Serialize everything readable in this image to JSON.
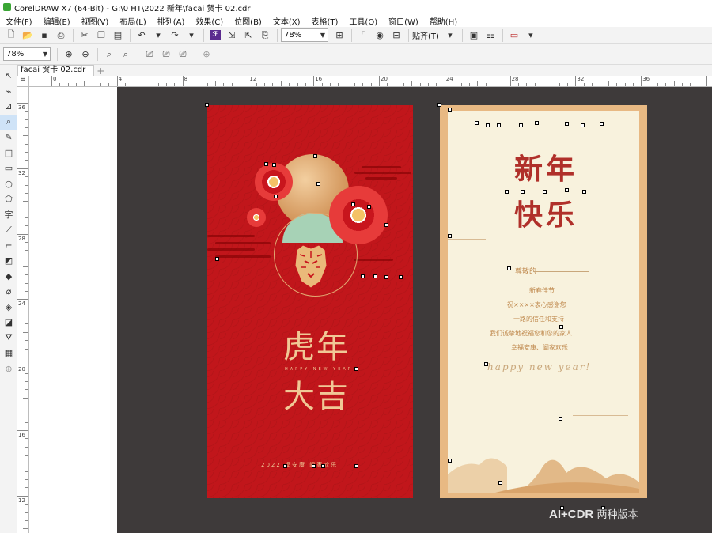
{
  "window": {
    "title": "CorelDRAW X7 (64-Bit) - G:\\0 HT\\2022 新年\\facai 贺卡 02.cdr"
  },
  "menu": [
    "文件(F)",
    "编辑(E)",
    "视图(V)",
    "布局(L)",
    "排列(A)",
    "效果(C)",
    "位图(B)",
    "文本(X)",
    "表格(T)",
    "工具(O)",
    "窗口(W)",
    "帮助(H)"
  ],
  "toolbar": {
    "zoom_value": "78%",
    "snap_label": "贴齐(T)",
    "publish_icon": "purple-square-icon"
  },
  "propertybar": {
    "zoom_value": "78%"
  },
  "tabs": {
    "active": "facai 贺卡 02.cdr",
    "add": "+"
  },
  "ruler": {
    "h_labels": [
      "0",
      "4",
      "8",
      "12",
      "16",
      "20",
      "24",
      "28",
      "32",
      "36"
    ],
    "v_labels": [
      "36",
      "32",
      "28",
      "24",
      "20",
      "16",
      "12"
    ]
  },
  "red_card": {
    "title_line1": "虎年",
    "title_line2": "大吉",
    "happy": "HAPPY NEW YEAR",
    "footer": "2022 福安康 阖家欢乐"
  },
  "cream_card": {
    "title_line1": "新年",
    "title_line2": "快乐",
    "greeting": "尊敬的",
    "lines": [
      "新春佳节",
      "祝××××衷心感谢您",
      "一路的信任和支持",
      "我们诚挚地祝福您和您的家人",
      "幸福安康、阖家欢乐"
    ],
    "script": "happy new year!"
  },
  "watermark": {
    "brand": "AI+CDR",
    "suffix": "两种版本"
  },
  "colors": {
    "red": "#c1161b",
    "gold": "#f0c896",
    "cream": "#f8f2dd",
    "frame": "#e8b983",
    "desktop": "#3e3a3a"
  }
}
